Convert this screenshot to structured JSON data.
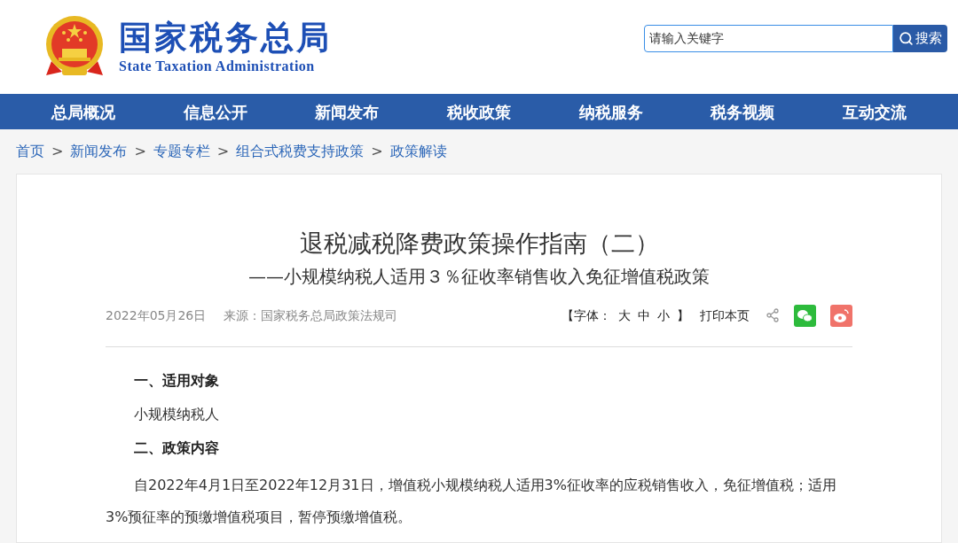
{
  "header": {
    "logo_title": "国家税务总局",
    "logo_subtitle": "State Taxation Administration",
    "search": {
      "placeholder": "请输入关键字",
      "button": "搜索"
    }
  },
  "nav": [
    {
      "label": "总局概况"
    },
    {
      "label": "信息公开"
    },
    {
      "label": "新闻发布"
    },
    {
      "label": "税收政策"
    },
    {
      "label": "纳税服务"
    },
    {
      "label": "税务视频"
    },
    {
      "label": "互动交流"
    }
  ],
  "breadcrumb": {
    "items": [
      "首页",
      "新闻发布",
      "专题专栏",
      "组合式税费支持政策",
      "政策解读"
    ],
    "separator": ">"
  },
  "article": {
    "title": "退税减税降费政策操作指南（二）",
    "subtitle": "——小规模纳税人适用３％征收率销售收入免征增值税政策",
    "date": "2022年05月26日",
    "source": "来源：国家税务总局政策法规司",
    "font_label_open": "【字体：",
    "font_sizes": [
      "大",
      "中",
      "小"
    ],
    "font_label_close": "】",
    "print": "打印本页",
    "body": [
      {
        "kind": "heading",
        "text": "一、适用对象"
      },
      {
        "kind": "text",
        "text": "小规模纳税人"
      },
      {
        "kind": "heading",
        "text": "二、政策内容"
      },
      {
        "kind": "paragraph",
        "text": "自2022年4月1日至2022年12月31日，增值税小规模纳税人适用3%征收率的应税销售收入，免征增值税；适用3%预征率的预缴增值税项目，暂停预缴增值税。"
      }
    ]
  }
}
